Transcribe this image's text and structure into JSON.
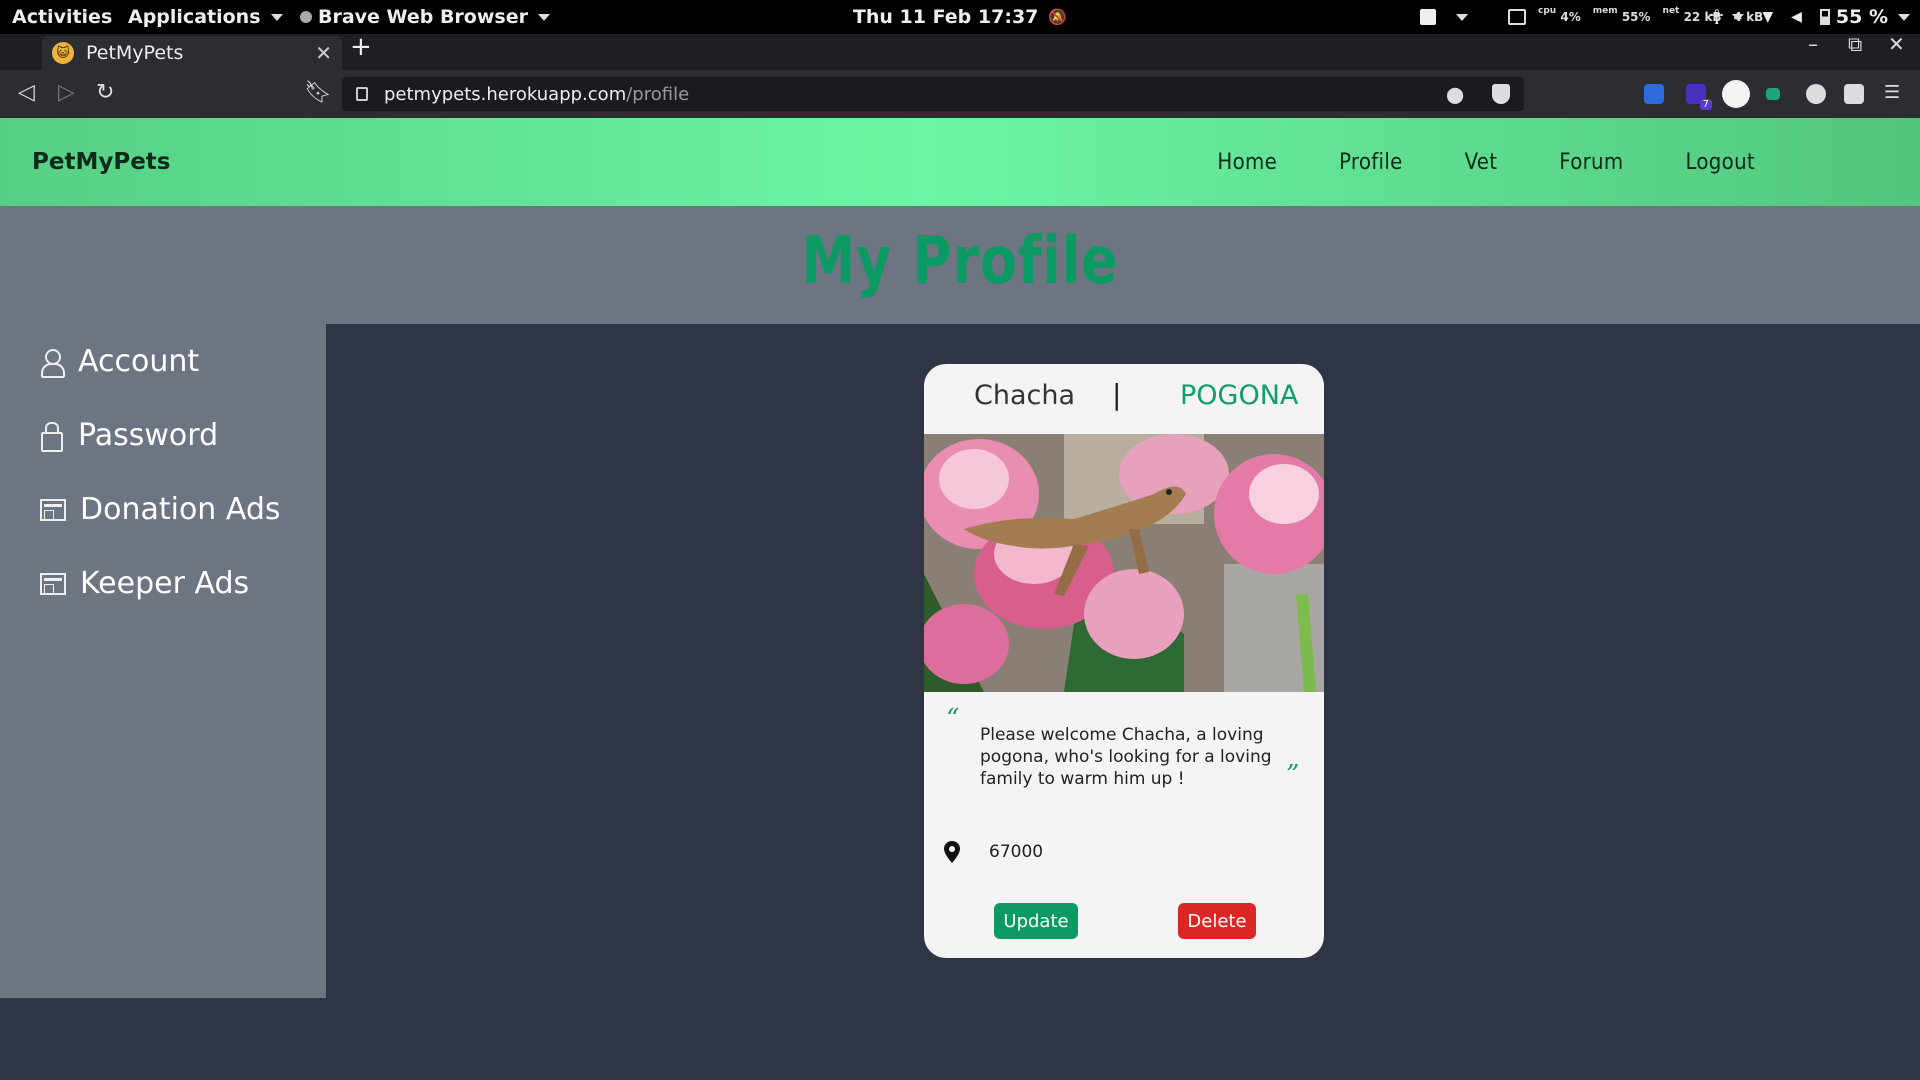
{
  "system_bar": {
    "activities": "Activities",
    "applications": "Applications",
    "browser_menu": "Brave Web Browser",
    "clock": "Thu 11 Feb  17:37",
    "cpu_label": "cpu",
    "cpu_value": "4%",
    "mem_label": "mem",
    "mem_value": "55%",
    "net_label": "net",
    "net_down": "22 kB",
    "net_up": "4 kB",
    "battery": "55 %"
  },
  "browser": {
    "tab_title": "PetMyPets",
    "url_host": "petmypets.herokuapp.com",
    "url_path": "/profile",
    "extension_badge": "7"
  },
  "site": {
    "brand": "PetMyPets",
    "nav": [
      "Home",
      "Profile",
      "Vet",
      "Forum",
      "Logout"
    ],
    "page_title": "My Profile"
  },
  "sidebar": {
    "items": [
      {
        "label": "Account",
        "icon": "user-icon"
      },
      {
        "label": "Password",
        "icon": "lock-icon"
      },
      {
        "label": "Donation Ads",
        "icon": "ads-icon"
      },
      {
        "label": "Keeper Ads",
        "icon": "ads-icon"
      }
    ]
  },
  "pet_card": {
    "name": "Chacha",
    "separator": "|",
    "species": "POGONA",
    "description": "Please welcome Chacha, a loving pogona, who's looking for a loving family to warm him up !",
    "quote_open": "“",
    "quote_close": "”",
    "zip": "67000",
    "update_label": "Update",
    "delete_label": "Delete"
  },
  "colors": {
    "accent_green": "#0b9a63",
    "header_gradient_start": "#56cf85",
    "header_gradient_mid": "#6cf5a4",
    "delete_red": "#dc2626",
    "panel_gray": "#6d7583",
    "page_bg": "#2f3545"
  }
}
